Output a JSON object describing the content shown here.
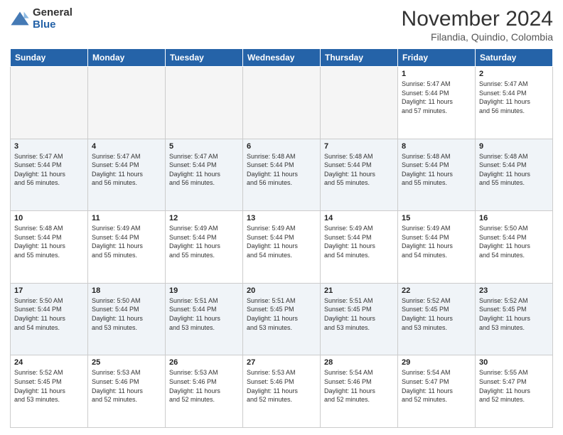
{
  "header": {
    "logo_general": "General",
    "logo_blue": "Blue",
    "month": "November 2024",
    "location": "Filandia, Quindio, Colombia"
  },
  "days_of_week": [
    "Sunday",
    "Monday",
    "Tuesday",
    "Wednesday",
    "Thursday",
    "Friday",
    "Saturday"
  ],
  "weeks": [
    [
      {
        "day": "",
        "info": "",
        "empty": true
      },
      {
        "day": "",
        "info": "",
        "empty": true
      },
      {
        "day": "",
        "info": "",
        "empty": true
      },
      {
        "day": "",
        "info": "",
        "empty": true
      },
      {
        "day": "",
        "info": "",
        "empty": true
      },
      {
        "day": "1",
        "info": "Sunrise: 5:47 AM\nSunset: 5:44 PM\nDaylight: 11 hours\nand 57 minutes."
      },
      {
        "day": "2",
        "info": "Sunrise: 5:47 AM\nSunset: 5:44 PM\nDaylight: 11 hours\nand 56 minutes."
      }
    ],
    [
      {
        "day": "3",
        "info": "Sunrise: 5:47 AM\nSunset: 5:44 PM\nDaylight: 11 hours\nand 56 minutes."
      },
      {
        "day": "4",
        "info": "Sunrise: 5:47 AM\nSunset: 5:44 PM\nDaylight: 11 hours\nand 56 minutes."
      },
      {
        "day": "5",
        "info": "Sunrise: 5:47 AM\nSunset: 5:44 PM\nDaylight: 11 hours\nand 56 minutes."
      },
      {
        "day": "6",
        "info": "Sunrise: 5:48 AM\nSunset: 5:44 PM\nDaylight: 11 hours\nand 56 minutes."
      },
      {
        "day": "7",
        "info": "Sunrise: 5:48 AM\nSunset: 5:44 PM\nDaylight: 11 hours\nand 55 minutes."
      },
      {
        "day": "8",
        "info": "Sunrise: 5:48 AM\nSunset: 5:44 PM\nDaylight: 11 hours\nand 55 minutes."
      },
      {
        "day": "9",
        "info": "Sunrise: 5:48 AM\nSunset: 5:44 PM\nDaylight: 11 hours\nand 55 minutes."
      }
    ],
    [
      {
        "day": "10",
        "info": "Sunrise: 5:48 AM\nSunset: 5:44 PM\nDaylight: 11 hours\nand 55 minutes."
      },
      {
        "day": "11",
        "info": "Sunrise: 5:49 AM\nSunset: 5:44 PM\nDaylight: 11 hours\nand 55 minutes."
      },
      {
        "day": "12",
        "info": "Sunrise: 5:49 AM\nSunset: 5:44 PM\nDaylight: 11 hours\nand 55 minutes."
      },
      {
        "day": "13",
        "info": "Sunrise: 5:49 AM\nSunset: 5:44 PM\nDaylight: 11 hours\nand 54 minutes."
      },
      {
        "day": "14",
        "info": "Sunrise: 5:49 AM\nSunset: 5:44 PM\nDaylight: 11 hours\nand 54 minutes."
      },
      {
        "day": "15",
        "info": "Sunrise: 5:49 AM\nSunset: 5:44 PM\nDaylight: 11 hours\nand 54 minutes."
      },
      {
        "day": "16",
        "info": "Sunrise: 5:50 AM\nSunset: 5:44 PM\nDaylight: 11 hours\nand 54 minutes."
      }
    ],
    [
      {
        "day": "17",
        "info": "Sunrise: 5:50 AM\nSunset: 5:44 PM\nDaylight: 11 hours\nand 54 minutes."
      },
      {
        "day": "18",
        "info": "Sunrise: 5:50 AM\nSunset: 5:44 PM\nDaylight: 11 hours\nand 53 minutes."
      },
      {
        "day": "19",
        "info": "Sunrise: 5:51 AM\nSunset: 5:44 PM\nDaylight: 11 hours\nand 53 minutes."
      },
      {
        "day": "20",
        "info": "Sunrise: 5:51 AM\nSunset: 5:45 PM\nDaylight: 11 hours\nand 53 minutes."
      },
      {
        "day": "21",
        "info": "Sunrise: 5:51 AM\nSunset: 5:45 PM\nDaylight: 11 hours\nand 53 minutes."
      },
      {
        "day": "22",
        "info": "Sunrise: 5:52 AM\nSunset: 5:45 PM\nDaylight: 11 hours\nand 53 minutes."
      },
      {
        "day": "23",
        "info": "Sunrise: 5:52 AM\nSunset: 5:45 PM\nDaylight: 11 hours\nand 53 minutes."
      }
    ],
    [
      {
        "day": "24",
        "info": "Sunrise: 5:52 AM\nSunset: 5:45 PM\nDaylight: 11 hours\nand 53 minutes."
      },
      {
        "day": "25",
        "info": "Sunrise: 5:53 AM\nSunset: 5:46 PM\nDaylight: 11 hours\nand 52 minutes."
      },
      {
        "day": "26",
        "info": "Sunrise: 5:53 AM\nSunset: 5:46 PM\nDaylight: 11 hours\nand 52 minutes."
      },
      {
        "day": "27",
        "info": "Sunrise: 5:53 AM\nSunset: 5:46 PM\nDaylight: 11 hours\nand 52 minutes."
      },
      {
        "day": "28",
        "info": "Sunrise: 5:54 AM\nSunset: 5:46 PM\nDaylight: 11 hours\nand 52 minutes."
      },
      {
        "day": "29",
        "info": "Sunrise: 5:54 AM\nSunset: 5:47 PM\nDaylight: 11 hours\nand 52 minutes."
      },
      {
        "day": "30",
        "info": "Sunrise: 5:55 AM\nSunset: 5:47 PM\nDaylight: 11 hours\nand 52 minutes."
      }
    ]
  ]
}
